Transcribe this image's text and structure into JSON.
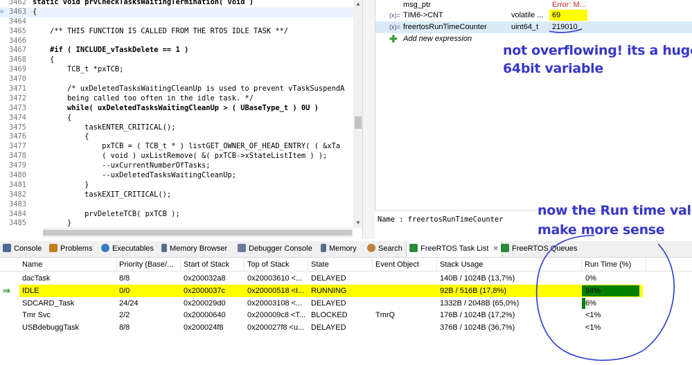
{
  "editor": {
    "lines": [
      {
        "n": "3462",
        "t": "static void prvCheckTasksWaitingTermination( void )"
      },
      {
        "n": "3463",
        "t": "{"
      },
      {
        "n": "3464",
        "t": ""
      },
      {
        "n": "3465",
        "t": "    /** THIS FUNCTION IS CALLED FROM THE RTOS IDLE TASK **/"
      },
      {
        "n": "3466",
        "t": ""
      },
      {
        "n": "3467",
        "t": "    #if ( INCLUDE_vTaskDelete == 1 )"
      },
      {
        "n": "3468",
        "t": "    {"
      },
      {
        "n": "3469",
        "t": "        TCB_t *pxTCB;"
      },
      {
        "n": "3470",
        "t": ""
      },
      {
        "n": "3471",
        "t": "        /* uxDeletedTasksWaitingCleanUp is used to prevent vTaskSuspendA"
      },
      {
        "n": "3472",
        "t": "        being called too often in the idle task. */"
      },
      {
        "n": "3473",
        "t": "        while( uxDeletedTasksWaitingCleanUp > ( UBaseType_t ) 0U )"
      },
      {
        "n": "3474",
        "t": "        {"
      },
      {
        "n": "3475",
        "t": "            taskENTER_CRITICAL();"
      },
      {
        "n": "3476",
        "t": "            {"
      },
      {
        "n": "3477",
        "t": "                pxTCB = ( TCB_t * ) listGET_OWNER_OF_HEAD_ENTRY( ( &xTa"
      },
      {
        "n": "3478",
        "t": "                ( void ) uxListRemove( &( pxTCB->xStateListItem ) );"
      },
      {
        "n": "3479",
        "t": "                --uxCurrentNumberOfTasks;"
      },
      {
        "n": "3480",
        "t": "                --uxDeletedTasksWaitingCleanUp;"
      },
      {
        "n": "3481",
        "t": "            }"
      },
      {
        "n": "3482",
        "t": "            taskEXIT_CRITICAL();"
      },
      {
        "n": "3483",
        "t": ""
      },
      {
        "n": "3484",
        "t": "            prvDeleteTCB( pxTCB );"
      },
      {
        "n": "3485",
        "t": "        }"
      }
    ]
  },
  "expressions": {
    "rows": [
      {
        "icon": "",
        "name": "msg_ptr",
        "type": "",
        "value": "Error: M..."
      },
      {
        "icon": "(x)=",
        "name": "TIM6->CNT",
        "type": "volatile ...",
        "value": "69"
      },
      {
        "icon": "(x)=",
        "name": "freertosRunTimeCounter",
        "type": "uint64_t",
        "value": "219010"
      }
    ],
    "add_label": "Add new expression",
    "detail": "Name : freertosRunTimeCounter"
  },
  "annotations": {
    "note1_line1": "not overflowing! its a huge",
    "note1_line2": "64bit variable",
    "note2_line1": "now the Run time value",
    "note2_line2": "make more sense"
  },
  "tabs": [
    {
      "label": "Console"
    },
    {
      "label": "Problems"
    },
    {
      "label": "Executables"
    },
    {
      "label": "Memory Browser"
    },
    {
      "label": "Debugger Console"
    },
    {
      "label": "Memory"
    },
    {
      "label": "Search"
    },
    {
      "label": "FreeRTOS Task List"
    },
    {
      "label": "FreeRTOS Queues"
    }
  ],
  "task_table": {
    "headers": [
      "Name",
      "Priority (Base/...",
      "Start of Stack",
      "Top of Stack",
      "State",
      "Event Object",
      "Stack Usage",
      "Run Time (%)"
    ],
    "rows": [
      {
        "name": "dacTask",
        "priority": "8/8",
        "start": "0x200032a8",
        "top": "0x20003610 <...",
        "state": "DELAYED",
        "event": "",
        "stack": "140B / 1024B (13,7%)",
        "runtime": "0%",
        "runtime_fraction": 0.0
      },
      {
        "name": "IDLE",
        "priority": "0/0",
        "start": "0x2000037c",
        "top": "0x20000518 <I...",
        "state": "RUNNING",
        "event": "",
        "stack": "92B / 516B (17,8%)",
        "runtime": "94%",
        "runtime_fraction": 0.94
      },
      {
        "name": "SDCARD_Task",
        "priority": "24/24",
        "start": "0x200029d0",
        "top": "0x20003108 <...",
        "state": "DELAYED",
        "event": "",
        "stack": "1332B / 2048B (65,0%)",
        "runtime": "6%",
        "runtime_fraction": 0.06
      },
      {
        "name": "Tmr Svc",
        "priority": "2/2",
        "start": "0x20000640",
        "top": "0x200009c8 <T...",
        "state": "BLOCKED",
        "event": "TmrQ",
        "stack": "176B / 1024B (17,2%)",
        "runtime": "<1%",
        "runtime_fraction": 0.0
      },
      {
        "name": "USBdebuggTask",
        "priority": "8/8",
        "start": "0x200024f8",
        "top": "0x200027f8 <u...",
        "state": "DELAYED",
        "event": "",
        "stack": "376B / 1024B (36,7%)",
        "runtime": "<1%",
        "runtime_fraction": 0.0
      }
    ]
  },
  "colors": {
    "highlight": "#ffff00",
    "runbar": "#008000",
    "annotation": "#3838c8"
  }
}
